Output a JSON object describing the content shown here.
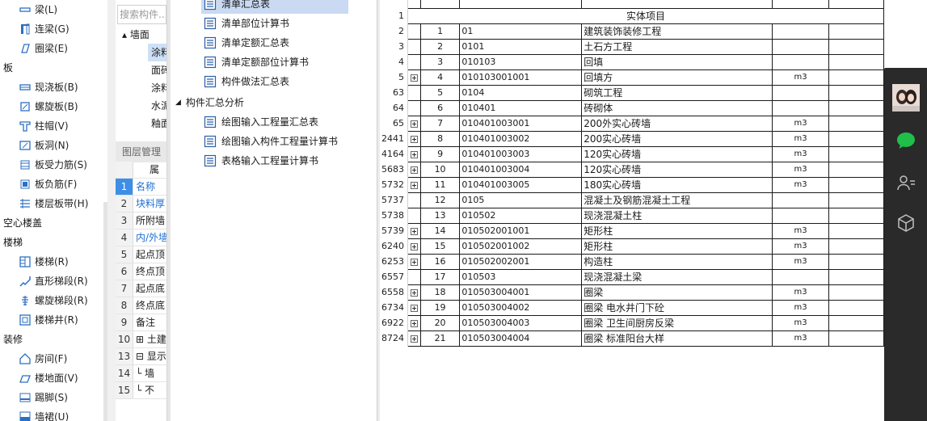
{
  "modules": [
    {
      "type": "item",
      "label": "梁(L)",
      "icon": "beam-icon"
    },
    {
      "type": "item",
      "label": "连梁(G)",
      "icon": "coupling-beam-icon"
    },
    {
      "type": "item",
      "label": "圈梁(E)",
      "icon": "ring-beam-icon"
    },
    {
      "type": "group",
      "label": "板"
    },
    {
      "type": "item",
      "label": "现浇板(B)",
      "icon": "slab-icon"
    },
    {
      "type": "item",
      "label": "螺旋板(B)",
      "icon": "spiral-slab-icon"
    },
    {
      "type": "item",
      "label": "柱帽(V)",
      "icon": "column-cap-icon"
    },
    {
      "type": "item",
      "label": "板洞(N)",
      "icon": "slab-hole-icon"
    },
    {
      "type": "item",
      "label": "板受力筋(S)",
      "icon": "slab-rebar-icon"
    },
    {
      "type": "item",
      "label": "板负筋(F)",
      "icon": "negative-rebar-icon"
    },
    {
      "type": "item",
      "label": "楼层板带(H)",
      "icon": "floor-strip-icon"
    },
    {
      "type": "group",
      "label": "空心楼盖"
    },
    {
      "type": "group",
      "label": "楼梯"
    },
    {
      "type": "item",
      "label": "楼梯(R)",
      "icon": "stair-icon"
    },
    {
      "type": "item",
      "label": "直形梯段(R)",
      "icon": "straight-flight-icon"
    },
    {
      "type": "item",
      "label": "螺旋梯段(R)",
      "icon": "spiral-flight-icon"
    },
    {
      "type": "item",
      "label": "楼梯井(R)",
      "icon": "stairwell-icon"
    },
    {
      "type": "group",
      "label": "装修"
    },
    {
      "type": "item",
      "label": "房间(F)",
      "icon": "room-icon"
    },
    {
      "type": "item",
      "label": "楼地面(V)",
      "icon": "floor-icon"
    },
    {
      "type": "item",
      "label": "踢脚(S)",
      "icon": "skirting-icon"
    },
    {
      "type": "item",
      "label": "墙裙(U)",
      "icon": "dado-icon"
    }
  ],
  "prop": {
    "search_placeholder": "搜索构件...",
    "tree": [
      {
        "label": "▴ 墙面",
        "indent": 8,
        "selected": false
      },
      {
        "label": "涂料",
        "indent": 44,
        "selected": true
      },
      {
        "label": "面砖",
        "indent": 44,
        "selected": false
      },
      {
        "label": "涂料",
        "indent": 44,
        "selected": false
      },
      {
        "label": "水泥",
        "indent": 44,
        "selected": false
      },
      {
        "label": "釉面",
        "indent": 44,
        "selected": false
      }
    ],
    "layer_title": "图层管理",
    "col_header": "属",
    "rows": [
      {
        "num": "1",
        "name": "名称",
        "blue": true,
        "selected": true
      },
      {
        "num": "2",
        "name": "块料厚",
        "blue": true,
        "selected": false
      },
      {
        "num": "3",
        "name": "所附墙",
        "blue": false,
        "selected": false
      },
      {
        "num": "4",
        "name": "内/外墙",
        "blue": true,
        "selected": false
      },
      {
        "num": "5",
        "name": "起点顶",
        "blue": false,
        "selected": false
      },
      {
        "num": "6",
        "name": "终点顶",
        "blue": false,
        "selected": false
      },
      {
        "num": "7",
        "name": "起点底",
        "blue": false,
        "selected": false
      },
      {
        "num": "8",
        "name": "终点底",
        "blue": false,
        "selected": false
      },
      {
        "num": "9",
        "name": "备注",
        "blue": false,
        "selected": false
      },
      {
        "num": "10",
        "name": "⊞ 土建",
        "blue": false,
        "selected": false
      },
      {
        "num": "13",
        "name": "⊟ 显示",
        "blue": false,
        "selected": false
      },
      {
        "num": "14",
        "name": "  └ 墙",
        "blue": false,
        "selected": false
      },
      {
        "num": "15",
        "name": "  └ 不",
        "blue": false,
        "selected": false
      }
    ]
  },
  "reports": {
    "items": [
      {
        "label": "清单汇总表",
        "selected": true
      },
      {
        "label": "清单部位计算书",
        "selected": false
      },
      {
        "label": "清单定额汇总表",
        "selected": false
      },
      {
        "label": "清单定额部位计算书",
        "selected": false
      },
      {
        "label": "构件做法汇总表",
        "selected": false
      }
    ],
    "group_label": "构件汇总分析",
    "sub_items": [
      {
        "label": "绘图输入工程量汇总表"
      },
      {
        "label": "绘图输入构件工程量计算书"
      },
      {
        "label": "表格输入工程量计算书"
      }
    ]
  },
  "sheet": {
    "header_row_num": "1",
    "header_title": "实体项目",
    "rows": [
      {
        "row": "2",
        "expand": false,
        "seq": "1",
        "code": "01",
        "name": "建筑装饰装修工程",
        "unit": ""
      },
      {
        "row": "3",
        "expand": false,
        "seq": "2",
        "code": "0101",
        "name": "土石方工程",
        "unit": ""
      },
      {
        "row": "4",
        "expand": false,
        "seq": "3",
        "code": "010103",
        "name": "回填",
        "unit": ""
      },
      {
        "row": "5",
        "expand": true,
        "seq": "4",
        "code": "010103001001",
        "name": "回填方",
        "unit": "m3"
      },
      {
        "row": "63",
        "expand": false,
        "seq": "5",
        "code": "0104",
        "name": "砌筑工程",
        "unit": ""
      },
      {
        "row": "64",
        "expand": false,
        "seq": "6",
        "code": "010401",
        "name": "砖砌体",
        "unit": ""
      },
      {
        "row": "65",
        "expand": true,
        "seq": "7",
        "code": "010401003001",
        "name": "200外实心砖墙",
        "unit": "m3"
      },
      {
        "row": "2441",
        "expand": true,
        "seq": "8",
        "code": "010401003002",
        "name": "200实心砖墙",
        "unit": "m3"
      },
      {
        "row": "4164",
        "expand": true,
        "seq": "9",
        "code": "010401003003",
        "name": "120实心砖墙",
        "unit": "m3"
      },
      {
        "row": "5683",
        "expand": true,
        "seq": "10",
        "code": "010401003004",
        "name": "120实心砖墙",
        "unit": "m3"
      },
      {
        "row": "5732",
        "expand": true,
        "seq": "11",
        "code": "010401003005",
        "name": "180实心砖墙",
        "unit": "m3"
      },
      {
        "row": "5737",
        "expand": false,
        "seq": "12",
        "code": "0105",
        "name": "混凝土及钢筋混凝土工程",
        "unit": ""
      },
      {
        "row": "5738",
        "expand": false,
        "seq": "13",
        "code": "010502",
        "name": "现浇混凝土柱",
        "unit": ""
      },
      {
        "row": "5739",
        "expand": true,
        "seq": "14",
        "code": "010502001001",
        "name": "矩形柱",
        "unit": "m3"
      },
      {
        "row": "6240",
        "expand": true,
        "seq": "15",
        "code": "010502001002",
        "name": "矩形柱",
        "unit": "m3"
      },
      {
        "row": "6253",
        "expand": true,
        "seq": "16",
        "code": "010502002001",
        "name": "构造柱",
        "unit": "m3"
      },
      {
        "row": "6557",
        "expand": false,
        "seq": "17",
        "code": "010503",
        "name": "现浇混凝土梁",
        "unit": ""
      },
      {
        "row": "6558",
        "expand": true,
        "seq": "18",
        "code": "010503004001",
        "name": "圈梁",
        "unit": "m3"
      },
      {
        "row": "6734",
        "expand": true,
        "seq": "19",
        "code": "010503004002",
        "name": "圈梁  电水井门下砼",
        "unit": "m3"
      },
      {
        "row": "6922",
        "expand": true,
        "seq": "20",
        "code": "010503004003",
        "name": "圈梁  卫生间厨房反梁",
        "unit": "m3"
      },
      {
        "row": "8724",
        "expand": true,
        "seq": "21",
        "code": "010503004004",
        "name": "圈梁  标准阳台大样",
        "unit": "m3"
      }
    ]
  },
  "sidebar": {
    "buttons": [
      {
        "name": "avatar",
        "icon": "avatar"
      },
      {
        "name": "chat-icon",
        "icon": "chat-icon"
      },
      {
        "name": "contacts-icon",
        "icon": "contacts-icon"
      },
      {
        "name": "cube-icon",
        "icon": "cube-icon"
      }
    ]
  },
  "colors": {
    "accent": "#1f6fd1",
    "chat_green": "#1fbf4a",
    "selection": "#c9daf2",
    "sidebar": "#2a2a2a"
  }
}
